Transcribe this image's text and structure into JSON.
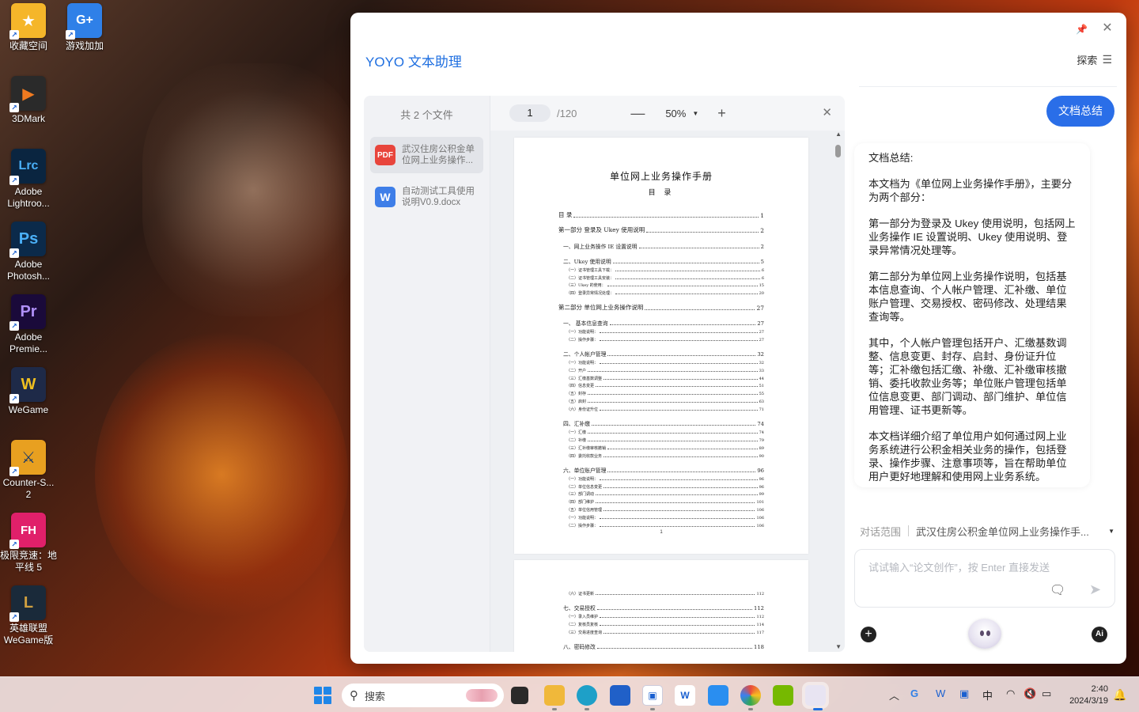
{
  "desktop": {
    "icons": [
      {
        "label": "收藏空间",
        "icon": "star-folder-icon",
        "color": "#f5b62a"
      },
      {
        "label": "游戏加加",
        "icon": "gplus-icon",
        "color": "#2f80e8"
      },
      {
        "label": "3DMark",
        "icon": "3dmark-icon",
        "color": "#2a2a2a"
      },
      {
        "label": "Adobe Lightroo...",
        "icon": "lightroom-icon",
        "color": "#0a2540"
      },
      {
        "label": "Adobe Photosh...",
        "icon": "photoshop-icon",
        "color": "#0b2a4a"
      },
      {
        "label": "Adobe Premie...",
        "icon": "premiere-icon",
        "color": "#1a0a3a"
      },
      {
        "label": "WeGame",
        "icon": "wegame-icon",
        "color": "#1e2a48"
      },
      {
        "label": "Counter-S... 2",
        "icon": "counter-strike-icon",
        "color": "#e8a020"
      },
      {
        "label": "极限竞速：地平线 5",
        "icon": "forza-icon",
        "color": "#e0206a"
      },
      {
        "label": "英雄联盟 WeGame版",
        "icon": "league-icon",
        "color": "#1a2a3a"
      }
    ],
    "glyphs": [
      "★",
      "G+",
      "▶",
      "Lrc",
      "Ps",
      "Pr",
      "W",
      "⚔",
      "FH",
      "L"
    ]
  },
  "app": {
    "title": "YOYO 文本助理",
    "explore_label": "探索",
    "accent": "#2a6ee8"
  },
  "viewer": {
    "file_count": "共 2 个文件",
    "files": [
      {
        "type": "PDF",
        "name": "武汉住房公积金单位网上业务操作..."
      },
      {
        "type": "W",
        "name": "自动测试工具使用说明V0.9.docx"
      }
    ],
    "current_page": "1",
    "total_pages": "/120",
    "zoom": "50%"
  },
  "document": {
    "title": "单位网上业务操作手册",
    "subtitle": "目 录",
    "page_number": "1",
    "toc": [
      {
        "lv": 1,
        "t": "目    录",
        "p": "1"
      },
      {
        "lv": 1,
        "t": "第一部分  登录及 Ukey 使用说明",
        "p": "2"
      },
      {
        "lv": 2,
        "t": "一、网上业务操作 IE 设置说明",
        "p": "2"
      },
      {
        "lv": 2,
        "t": "二、Ukey 使用说明",
        "p": "5"
      },
      {
        "lv": 3,
        "t": "（一）证书管理工具下载：",
        "p": "6"
      },
      {
        "lv": 3,
        "t": "（二）证书管理工具安装：",
        "p": "6"
      },
      {
        "lv": 3,
        "t": "（三）Ukey 的使用：",
        "p": "15"
      },
      {
        "lv": 3,
        "t": "（四）登录异常情况处理：",
        "p": "20"
      },
      {
        "lv": 1,
        "t": "第二部分  单位网上业务操作说明",
        "p": "27"
      },
      {
        "lv": 2,
        "t": "一、    基本信息查询",
        "p": "27"
      },
      {
        "lv": 3,
        "t": "（一）功能说明：",
        "p": "27"
      },
      {
        "lv": 3,
        "t": "（二）操作步骤：",
        "p": "27"
      },
      {
        "lv": 2,
        "t": "二、个人帐户管理",
        "p": "32"
      },
      {
        "lv": 3,
        "t": "（一）功能说明：",
        "p": "32"
      },
      {
        "lv": 3,
        "t": "（二）开户",
        "p": "33"
      },
      {
        "lv": 3,
        "t": "（三）汇缴基数调整",
        "p": "44"
      },
      {
        "lv": 3,
        "t": "（四）信息变更",
        "p": "51"
      },
      {
        "lv": 3,
        "t": "（五）封存",
        "p": "55"
      },
      {
        "lv": 3,
        "t": "（五）启封",
        "p": "63"
      },
      {
        "lv": 3,
        "t": "（六）身份证升位",
        "p": "71"
      },
      {
        "lv": 2,
        "t": "四、汇补缴",
        "p": "74"
      },
      {
        "lv": 3,
        "t": "（一）汇缴",
        "p": "74"
      },
      {
        "lv": 3,
        "t": "（二）补缴",
        "p": "79"
      },
      {
        "lv": 3,
        "t": "（三）汇补缴审核撤销",
        "p": "89"
      },
      {
        "lv": 3,
        "t": "（四）委托收款业务",
        "p": "90"
      },
      {
        "lv": 2,
        "t": "六、单位账户管理",
        "p": "96"
      },
      {
        "lv": 3,
        "t": "（一）功能说明：",
        "p": "96"
      },
      {
        "lv": 3,
        "t": "（二）单位信息变更",
        "p": "96"
      },
      {
        "lv": 3,
        "t": "（三）部门调动",
        "p": "99"
      },
      {
        "lv": 3,
        "t": "（四）部门维护",
        "p": "101"
      },
      {
        "lv": 3,
        "t": "（五）单位信用管理",
        "p": "106"
      },
      {
        "lv": 3,
        "t": "（一）功能说明：",
        "p": "106"
      },
      {
        "lv": 3,
        "t": "（二）操作步骤：",
        "p": "106"
      }
    ],
    "toc_page2": [
      {
        "lv": 3,
        "t": "（六）证书更新",
        "p": "112"
      },
      {
        "lv": 2,
        "t": "七、交易授权",
        "p": "112"
      },
      {
        "lv": 3,
        "t": "（一）录入员维护",
        "p": "112"
      },
      {
        "lv": 3,
        "t": "（二）复核员复核",
        "p": "114"
      },
      {
        "lv": 3,
        "t": "（三）交易进度查询",
        "p": "117"
      },
      {
        "lv": 2,
        "t": "八、密码修改",
        "p": "118"
      }
    ]
  },
  "chat": {
    "summary_button": "文档总结",
    "summary_paragraphs": [
      "文档总结:",
      "本文档为《单位网上业务操作手册》，主要分为两个部分：",
      "第一部分为登录及 Ukey 使用说明，包括网上业务操作 IE 设置说明、Ukey 使用说明、登录异常情况处理等。",
      "第二部分为单位网上业务操作说明，包括基本信息查询、个人帐户管理、汇补缴、单位账户管理、交易授权、密码修改、处理结果查询等。",
      "其中，个人帐户管理包括开户、汇缴基数调整、信息变更、封存、启封、身份证升位等；汇补缴包括汇缴、补缴、汇补缴审核撤销、委托收款业务等；单位账户管理包括单位信息变更、部门调动、部门维护、单位信用管理、证书更新等。",
      "本文档详细介绍了单位用户如何通过网上业务系统进行公积金相关业务的操作，包括登录、操作步骤、注意事项等，旨在帮助单位用户更好地理解和使用网上业务系统。"
    ],
    "scope_label": "对话范围",
    "scope_value": "武汉住房公积金单位网上业务操作手...",
    "input_placeholder": "试试输入“论文创作”，按 Enter 直接发送"
  },
  "taskbar": {
    "search_placeholder": "搜索",
    "ime": "中",
    "time": "2:40",
    "date": "2024/3/19"
  }
}
